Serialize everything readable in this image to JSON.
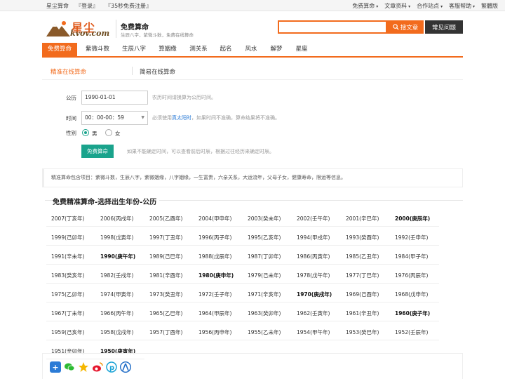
{
  "topbar": {
    "left": [
      "星尘算命",
      "『登录』",
      "『35秒免费注册』"
    ],
    "right": [
      "免费算命",
      "文章资料",
      "合作站点",
      "客服帮助",
      "繁體版"
    ]
  },
  "header": {
    "logo_cn": "星尘",
    "logo_en": "kvov.com",
    "title": "免费算命",
    "subtitle": "生辰八字，紫微斗数，免费在线算命",
    "search_button": "搜文章",
    "faq_button": "常见问题"
  },
  "nav": [
    "免费算命",
    "紫微斗数",
    "生辰八字",
    "算姻缘",
    "测关系",
    "起名",
    "风水",
    "解梦",
    "星座"
  ],
  "subtabs": [
    "精准在线算命",
    "简易在线算命"
  ],
  "form": {
    "date_label": "公历",
    "date_value": "1990-01-01",
    "date_hint": "农历时间请换算为公历时间。",
    "time_label": "时间",
    "time_value": "00：00-00：59",
    "time_hint_pre": "必须使用",
    "time_hint_link": "真太阳时",
    "time_hint_post": "，如果时间不准确，算命结果将不准确。",
    "gender_label": "性别",
    "male": "男",
    "female": "女",
    "submit": "免费算命",
    "submit_hint": "如果不能确定时间，可以查看前后时辰，根据过往经历来确定时辰。"
  },
  "info": "精准算命包含项目：紫微斗数，生辰八字，紫微姻缘，八字姻缘，一生富贵，六亲关系，大运流年，父母子女，健康寿命，限运等信息。",
  "years": {
    "title": "免费精准算命-选择出生年份-公历",
    "items": [
      [
        "2007(丁亥年)",
        "2006(丙戌年)",
        "2005(乙酉年)",
        "2004(甲申年)",
        "2003(癸未年)",
        "2002(壬午年)",
        "2001(辛巳年)",
        "2000(庚辰年)"
      ],
      [
        "1999(己卯年)",
        "1998(戊寅年)",
        "1997(丁丑年)",
        "1996(丙子年)",
        "1995(乙亥年)",
        "1994(甲戌年)",
        "1993(癸酉年)",
        "1992(壬申年)"
      ],
      [
        "1991(辛未年)",
        "1990(庚午年)",
        "1989(己巳年)",
        "1988(戊辰年)",
        "1987(丁卯年)",
        "1986(丙寅年)",
        "1985(乙丑年)",
        "1984(甲子年)"
      ],
      [
        "1983(癸亥年)",
        "1982(壬戌年)",
        "1981(辛酉年)",
        "1980(庚申年)",
        "1979(己未年)",
        "1978(戊午年)",
        "1977(丁巳年)",
        "1976(丙辰年)"
      ],
      [
        "1975(乙卯年)",
        "1974(甲寅年)",
        "1973(癸丑年)",
        "1972(壬子年)",
        "1971(辛亥年)",
        "1970(庚戌年)",
        "1969(己酉年)",
        "1968(戊申年)"
      ],
      [
        "1967(丁未年)",
        "1966(丙午年)",
        "1965(乙巳年)",
        "1964(甲辰年)",
        "1963(癸卯年)",
        "1962(壬寅年)",
        "1961(辛丑年)",
        "1960(庚子年)"
      ],
      [
        "1959(己亥年)",
        "1958(戊戌年)",
        "1957(丁酉年)",
        "1956(丙申年)",
        "1955(乙未年)",
        "1954(甲午年)",
        "1953(癸巳年)",
        "1952(壬辰年)"
      ],
      [
        "1951(辛卯年)",
        "1950(庚寅年)"
      ]
    ],
    "bold": [
      "2000(庚辰年)",
      "1990(庚午年)",
      "1980(庚申年)",
      "1970(庚戌年)",
      "1960(庚子年)",
      "1950(庚寅年)"
    ]
  },
  "share_icons": [
    "plus-share-icon",
    "wechat-icon",
    "qzone-icon",
    "weibo-icon",
    "pocket-icon",
    "renren-icon"
  ],
  "colors": {
    "accent": "#f26b1d",
    "button_green": "#1aa38c",
    "dark_button": "#333333"
  }
}
